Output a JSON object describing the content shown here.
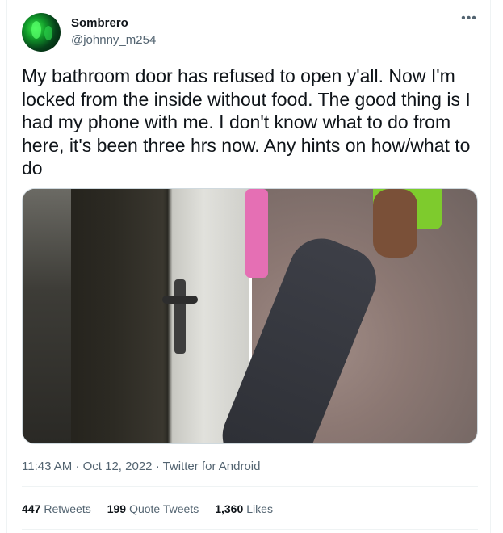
{
  "author": {
    "name": "Sombrero",
    "handle": "@johnny_m254"
  },
  "tweet": {
    "text": "My bathroom door has refused to open y'all. Now I'm locked from the inside without food. The good thing is I had my phone with me. I don't know what to do from here, it's been three hrs now. Any hints on how/what to do"
  },
  "more_icon": "more-dots-icon",
  "meta": {
    "time": "11:43 AM",
    "separator": "·",
    "date": "Oct 12, 2022",
    "source": "Twitter for Android"
  },
  "stats": {
    "retweets_count": "447",
    "retweets_label": "Retweets",
    "quotes_count": "199",
    "quotes_label": "Quote Tweets",
    "likes_count": "1,360",
    "likes_label": "Likes"
  },
  "colors": {
    "text_primary": "#0f1419",
    "text_secondary": "#536471",
    "border": "#eff3f4"
  }
}
